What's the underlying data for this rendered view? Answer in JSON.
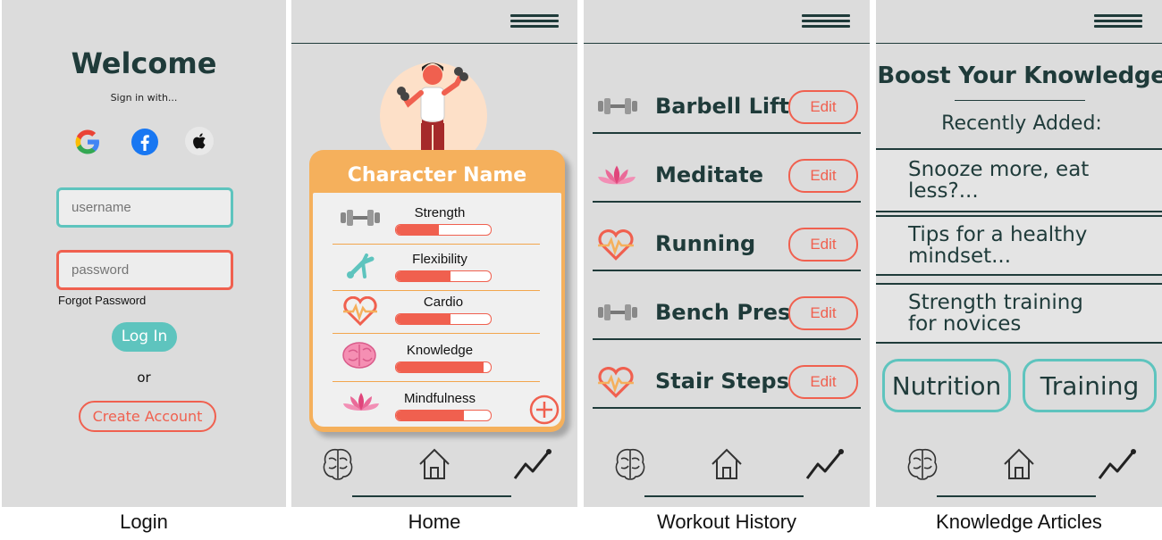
{
  "captions": [
    "Login",
    "Home",
    "Workout History",
    "Knowledge Articles"
  ],
  "colors": {
    "teal": "#5ec4be",
    "coral": "#f0604f",
    "orange": "#f5b05c",
    "dark": "#1f3b3a",
    "panel": "#dcdcdc"
  },
  "login": {
    "title": "Welcome",
    "subtitle": "Sign in with...",
    "providers": [
      "google-icon",
      "facebook-icon",
      "apple-icon"
    ],
    "username_placeholder": "username",
    "password_placeholder": "password",
    "forgot": "Forgot Password",
    "login_button": "Log In",
    "or": "or",
    "create_account": "Create Account"
  },
  "home": {
    "character_name": "Character Name",
    "stats": [
      {
        "label": "Strength",
        "icon": "dumbbell-icon",
        "value": 0.45
      },
      {
        "label": "Flexibility",
        "icon": "stretch-icon",
        "value": 0.58
      },
      {
        "label": "Cardio",
        "icon": "heartbeat-icon",
        "value": 0.58
      },
      {
        "label": "Knowledge",
        "icon": "brain-icon",
        "value": 0.92
      },
      {
        "label": "Mindfulness",
        "icon": "lotus-icon",
        "value": 0.72
      }
    ],
    "add_icon": "plus-icon"
  },
  "workouts": {
    "items": [
      {
        "label": "Barbell Lift",
        "icon": "dumbbell-icon",
        "edit": "Edit"
      },
      {
        "label": "Meditate",
        "icon": "lotus-icon",
        "edit": "Edit"
      },
      {
        "label": "Running",
        "icon": "heartbeat-icon",
        "edit": "Edit"
      },
      {
        "label": "Bench Press",
        "icon": "dumbbell-icon",
        "edit": "Edit"
      },
      {
        "label": "Stair Steps",
        "icon": "heartbeat-icon",
        "edit": "Edit"
      }
    ]
  },
  "knowledge": {
    "title": "Boost Your Knowledge",
    "recent": "Recently Added:",
    "articles": [
      {
        "line1": "Snooze more, eat",
        "line2": "less?..."
      },
      {
        "line1": "Tips for a healthy",
        "line2": "mindset..."
      },
      {
        "line1": "Strength training",
        "line2": "for novices"
      }
    ],
    "buttons": [
      "Nutrition",
      "Training"
    ]
  },
  "nav": [
    "brain-icon",
    "home-icon",
    "chart-icon"
  ]
}
